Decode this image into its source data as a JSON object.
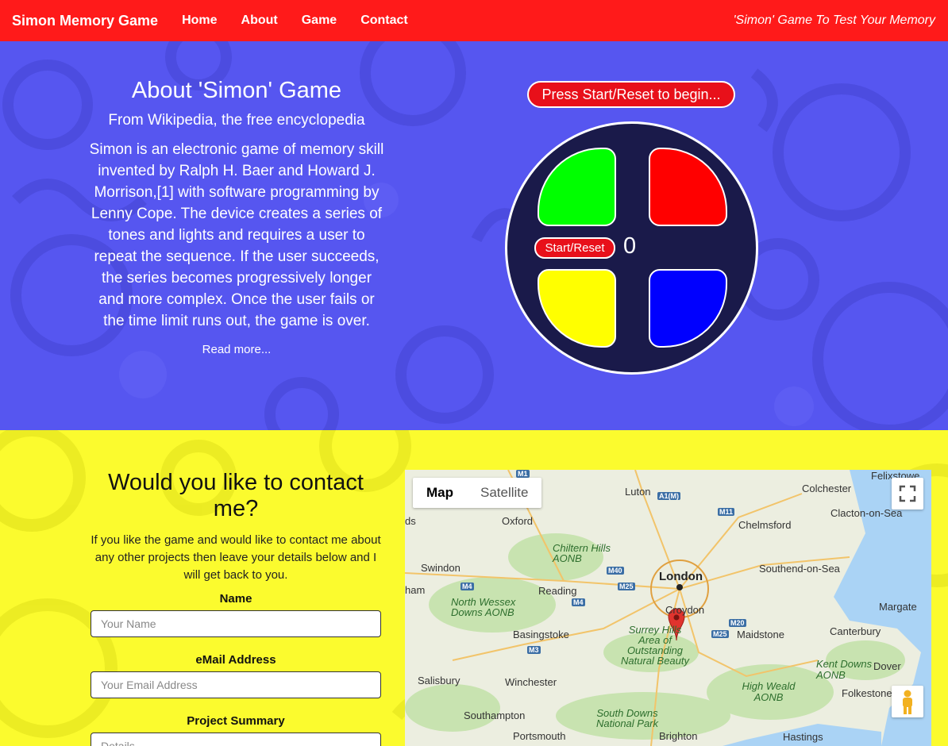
{
  "nav": {
    "brand": "Simon Memory Game",
    "links": [
      "Home",
      "About",
      "Game",
      "Contact"
    ],
    "tagline": "'Simon' Game To Test Your Memory"
  },
  "about": {
    "title": "About 'Simon' Game",
    "subtitle": "From Wikipedia, the free encyclopedia",
    "body": "Simon is an electronic game of memory skill invented by Ralph H. Baer and Howard J. Morrison,[1] with software programming by Lenny Cope. The device creates a series of tones and lights and requires a user to repeat the sequence. If the user succeeds, the series becomes progressively longer and more complex. Once the user fails or the time limit runs out, the game is over.",
    "read_more": "Read more..."
  },
  "game": {
    "status": "Press Start/Reset to begin...",
    "start_label": "Start/Reset",
    "count": "0",
    "colors": {
      "green": "#00ff00",
      "red": "#ff0000",
      "yellow": "#ffff00",
      "blue": "#0000ff"
    }
  },
  "contact": {
    "title": "Would you like to contact me?",
    "intro": "If you like the game and would like to contact me about any other projects then leave your details below and I will get back to you.",
    "name_label": "Name",
    "name_placeholder": "Your Name",
    "email_label": "eMail Address",
    "email_placeholder": "Your Email Address",
    "summary_label": "Project Summary",
    "summary_placeholder": "Details"
  },
  "map": {
    "type_map": "Map",
    "type_satellite": "Satellite",
    "places": {
      "luton": "Luton",
      "colchester": "Colchester",
      "felixstowe": "Felixstowe",
      "oxford": "Oxford",
      "chelmsford": "Chelmsford",
      "clacton": "Clacton-on-Sea",
      "chiltern": "Chiltern Hills AONB",
      "swindon": "Swindon",
      "london": "London",
      "southend": "Southend-on-Sea",
      "reading": "Reading",
      "wessex": "North Wessex Downs AONB",
      "croydon": "Croydon",
      "margate": "Margate",
      "basingstoke": "Basingstoke",
      "surrey": "Surrey Hills Area of Outstanding Natural Beauty",
      "maidstone": "Maidstone",
      "canterbury": "Canterbury",
      "kentdowns": "Kent Downs AONB",
      "dover": "Dover",
      "salisbury": "Salisbury",
      "winchester": "Winchester",
      "weald": "High Weald AONB",
      "folkestone": "Folkestone",
      "southampton": "Southampton",
      "southdowns": "South Downs National Park",
      "portsmouth": "Portsmouth",
      "brighton": "Brighton",
      "hastings": "Hastings",
      "ham": "ham",
      "ds": "ds"
    },
    "roads": [
      "A1(M)",
      "M11",
      "M40",
      "M25",
      "M4",
      "M4",
      "M3",
      "M20",
      "M25",
      "M1"
    ]
  },
  "colors": {
    "nav": "#ff1a1a",
    "hero": "#5656f0",
    "contact": "#fbfb2e",
    "button": "#e8101a"
  }
}
